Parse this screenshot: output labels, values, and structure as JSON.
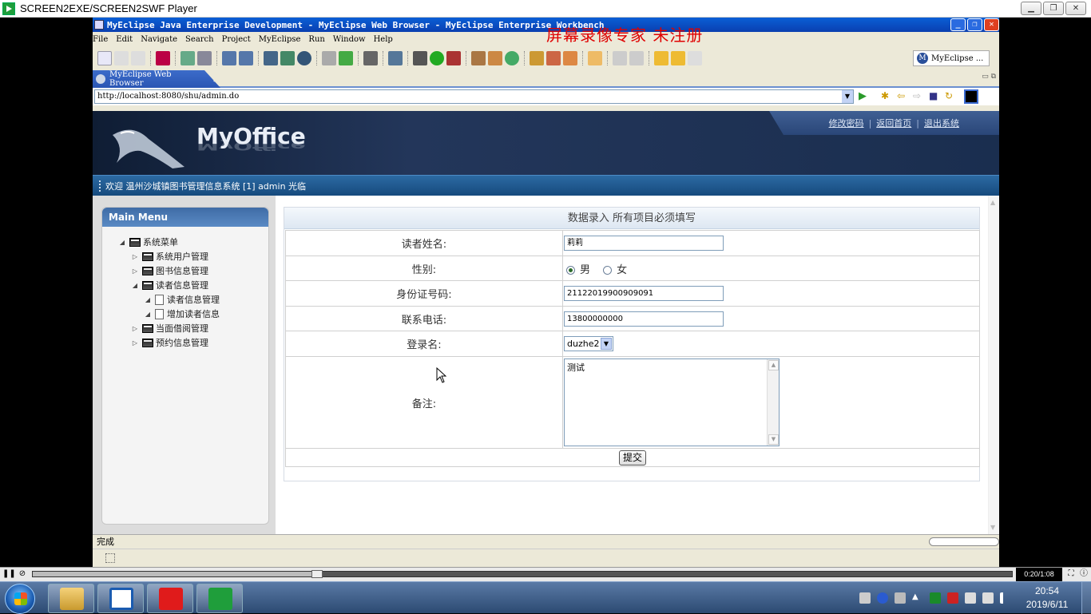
{
  "player": {
    "title": "SCREEN2EXE/SCREEN2SWF Player",
    "time": "0:20/1:08",
    "progress": 0.29
  },
  "eclipse": {
    "title": "MyEclipse Java Enterprise Development - MyEclipse Web Browser - MyEclipse Enterprise Workbench",
    "watermark": "屏幕录像专家  未注册",
    "menu": [
      "File",
      "Edit",
      "Navigate",
      "Search",
      "Project",
      "MyEclipse",
      "Run",
      "Window",
      "Help"
    ],
    "perspective": "MyEclipse ...",
    "tab_label": "MyEclipse Web Browser",
    "url": "http://localhost:8080/shu/admin.do",
    "status": "完成"
  },
  "site": {
    "logo": "MyOffice",
    "links": [
      "修改密码",
      "返回首页",
      "退出系统"
    ],
    "welcome": "欢迎 温州沙城镇图书管理信息系统 [1] admin 光临"
  },
  "sidebar": {
    "title": "Main Menu",
    "tree": [
      {
        "label": "系统菜单",
        "level": 0,
        "type": "folder",
        "toggle": "expanded"
      },
      {
        "label": "系统用户管理",
        "level": 1,
        "type": "folder",
        "toggle": "collapsed"
      },
      {
        "label": "图书信息管理",
        "level": 1,
        "type": "folder",
        "toggle": "collapsed"
      },
      {
        "label": "读者信息管理",
        "level": 1,
        "type": "folder",
        "toggle": "expanded"
      },
      {
        "label": "读者信息管理",
        "level": 2,
        "type": "doc",
        "toggle": "leaf"
      },
      {
        "label": "增加读者信息",
        "level": 2,
        "type": "doc",
        "toggle": "leaf"
      },
      {
        "label": "当面借阅管理",
        "level": 1,
        "type": "folder",
        "toggle": "collapsed"
      },
      {
        "label": "预约信息管理",
        "level": 1,
        "type": "folder",
        "toggle": "collapsed"
      }
    ]
  },
  "form": {
    "title": "数据录入 所有项目必须填写",
    "name_label": "读者姓名:",
    "name_value": "莉莉",
    "gender_label": "性别:",
    "gender_male": "男",
    "gender_female": "女",
    "gender_selected": "男",
    "id_label": "身份证号码:",
    "id_value": "21122019900909091",
    "phone_label": "联系电话:",
    "phone_value": "13800000000",
    "login_label": "登录名:",
    "login_value": "duzhe2",
    "note_label": "备注:",
    "note_value": "测试",
    "submit_label": "提交"
  },
  "taskbar": {
    "time": "20:54",
    "date": "2019/6/11"
  },
  "colors": {
    "watermark": "#e00000",
    "header_bg": "#1a2e4f",
    "welcome_bar": "#1f5a90",
    "accent_blue": "#3c6cc9"
  }
}
